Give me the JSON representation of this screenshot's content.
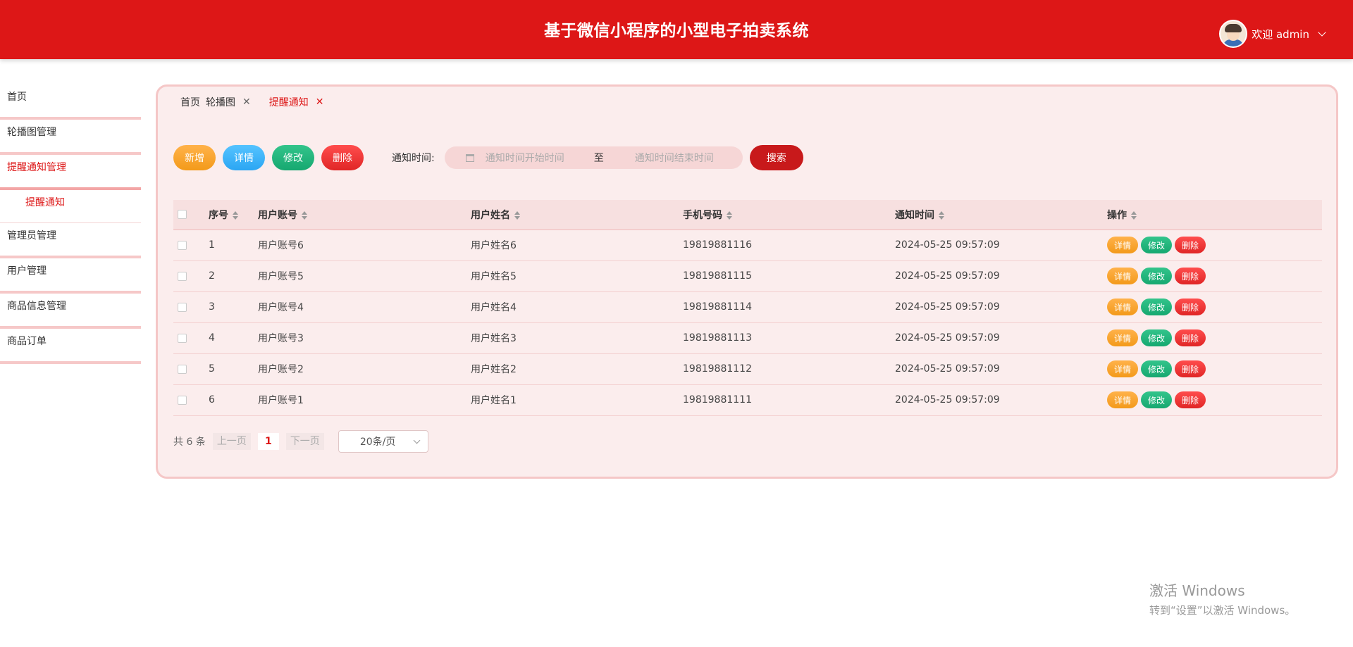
{
  "header": {
    "title": "基于微信小程序的小型电子拍卖系统",
    "welcome": "欢迎 admin"
  },
  "sidebar": {
    "items": [
      {
        "label": "首页"
      },
      {
        "label": "轮播图管理"
      },
      {
        "label": "提醒通知管理"
      },
      {
        "label": "管理员管理"
      },
      {
        "label": "用户管理"
      },
      {
        "label": "商品信息管理"
      },
      {
        "label": "商品订单"
      }
    ],
    "sub_label": "提醒通知"
  },
  "tabs": [
    {
      "label": "首页"
    },
    {
      "label": "轮播图"
    },
    {
      "label": "提醒通知"
    }
  ],
  "toolbar": {
    "add": "新增",
    "detail": "详情",
    "edit": "修改",
    "delete": "删除",
    "filter_label": "通知时间:",
    "start_placeholder": "通知时间开始时间",
    "range_sep": "至",
    "end_placeholder": "通知时间结束时间",
    "search": "搜索"
  },
  "table": {
    "headers": {
      "seq": "序号",
      "account": "用户账号",
      "name": "用户姓名",
      "phone": "手机号码",
      "time": "通知时间",
      "ops": "操作"
    },
    "row_actions": {
      "detail": "详情",
      "edit": "修改",
      "delete": "删除"
    },
    "rows": [
      {
        "seq": "1",
        "account": "用户账号6",
        "name": "用户姓名6",
        "phone": "19819881116",
        "time": "2024-05-25 09:57:09"
      },
      {
        "seq": "2",
        "account": "用户账号5",
        "name": "用户姓名5",
        "phone": "19819881115",
        "time": "2024-05-25 09:57:09"
      },
      {
        "seq": "3",
        "account": "用户账号4",
        "name": "用户姓名4",
        "phone": "19819881114",
        "time": "2024-05-25 09:57:09"
      },
      {
        "seq": "4",
        "account": "用户账号3",
        "name": "用户姓名3",
        "phone": "19819881113",
        "time": "2024-05-25 09:57:09"
      },
      {
        "seq": "5",
        "account": "用户账号2",
        "name": "用户姓名2",
        "phone": "19819881112",
        "time": "2024-05-25 09:57:09"
      },
      {
        "seq": "6",
        "account": "用户账号1",
        "name": "用户姓名1",
        "phone": "19819881111",
        "time": "2024-05-25 09:57:09"
      }
    ]
  },
  "pager": {
    "total": "共 6 条",
    "prev": "上一页",
    "current": "1",
    "next": "下一页",
    "size": "20条/页"
  },
  "watermark": {
    "line1": "激活 Windows",
    "line2": "转到“设置”以激活 Windows。"
  },
  "colors": {
    "brand": "#dd1717",
    "panel_bg": "#fbeded",
    "orange": "#f39a1a",
    "blue": "#2ba6f3",
    "green": "#16a870",
    "red": "#e02626"
  }
}
